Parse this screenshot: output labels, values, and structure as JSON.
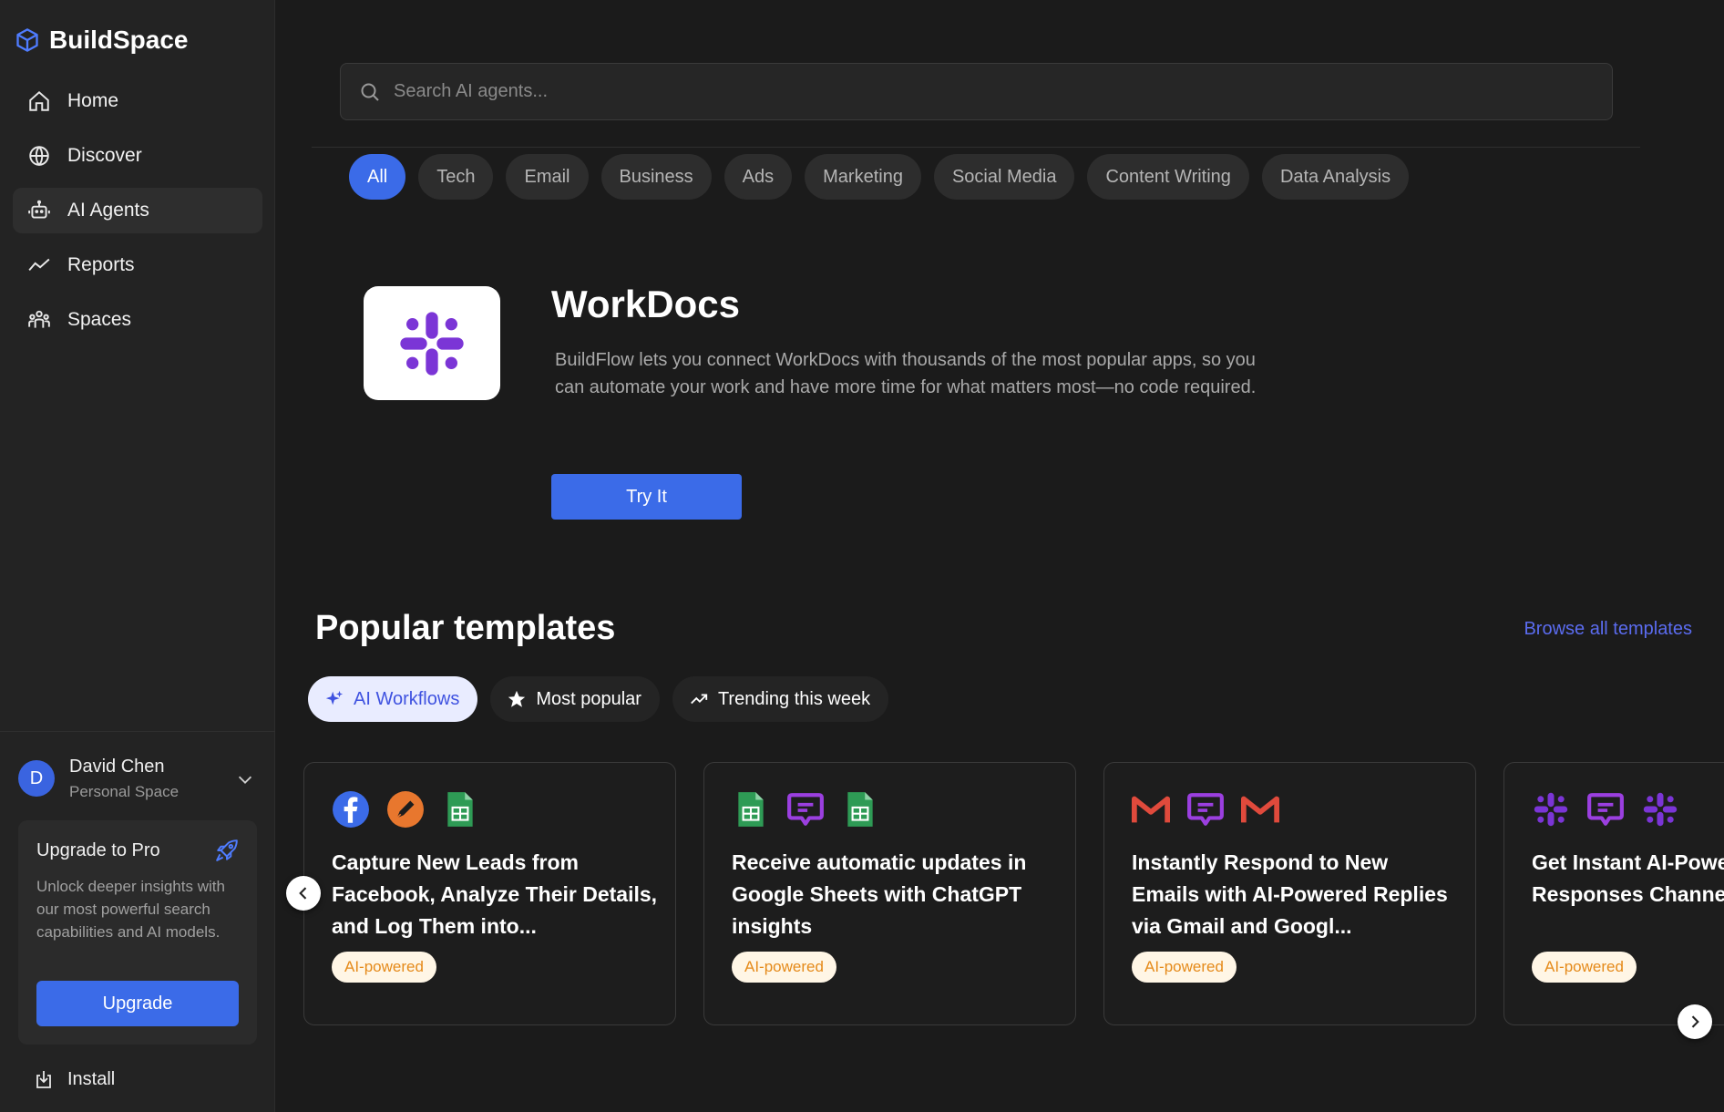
{
  "app": {
    "name": "BuildSpace"
  },
  "nav": [
    {
      "label": "Home",
      "icon": "home-icon"
    },
    {
      "label": "Discover",
      "icon": "globe-icon"
    },
    {
      "label": "AI Agents",
      "icon": "robot-icon",
      "active": true
    },
    {
      "label": "Reports",
      "icon": "trend-icon"
    },
    {
      "label": "Spaces",
      "icon": "people-icon"
    }
  ],
  "user": {
    "initial": "D",
    "name": "David Chen",
    "space": "Personal Space"
  },
  "upgrade": {
    "title": "Upgrade to Pro",
    "description": "Unlock deeper insights with our most powerful search capabilities and AI models.",
    "button": "Upgrade"
  },
  "install": {
    "label": "Install"
  },
  "search": {
    "placeholder": "Search AI agents..."
  },
  "categories": [
    "All",
    "Tech",
    "Email",
    "Business",
    "Ads",
    "Marketing",
    "Social Media",
    "Content Writing",
    "Data Analysis"
  ],
  "hero": {
    "title": "WorkDocs",
    "description": "BuildFlow lets you connect WorkDocs with thousands of the most popular apps, so you can automate your work and have more time for what matters most—no code required.",
    "button": "Try It"
  },
  "templates": {
    "title": "Popular templates",
    "browse": "Browse all templates",
    "tabs": [
      {
        "label": "AI Workflows",
        "icon": "sparkle-icon",
        "active": true
      },
      {
        "label": "Most popular",
        "icon": "star-icon"
      },
      {
        "label": "Trending this week",
        "icon": "trend-icon"
      }
    ],
    "cards": [
      {
        "icons": [
          "facebook-icon",
          "pen-tool-icon",
          "google-sheets-icon"
        ],
        "title": "Capture New Leads from Facebook, Analyze Their Details, and Log Them into...",
        "badge": "AI-powered"
      },
      {
        "icons": [
          "google-sheets-icon",
          "chat-icon",
          "google-sheets-icon"
        ],
        "title": "Receive automatic updates in Google Sheets with ChatGPT insights",
        "badge": "AI-powered"
      },
      {
        "icons": [
          "gmail-icon",
          "chat-icon",
          "gmail-icon"
        ],
        "title": "Instantly Respond to New Emails with AI-Powered Replies via Gmail and Googl...",
        "badge": "AI-powered"
      },
      {
        "icons": [
          "slack-icon",
          "chat-icon",
          "slack-icon"
        ],
        "title": "Get Instant AI-Powered Support Responses Channels",
        "badge": "AI-powered"
      }
    ]
  },
  "colors": {
    "accent": "#3b6be8",
    "link": "#5b6cf0",
    "slack": "#7b35d6",
    "badge_text": "#e58a1a"
  }
}
